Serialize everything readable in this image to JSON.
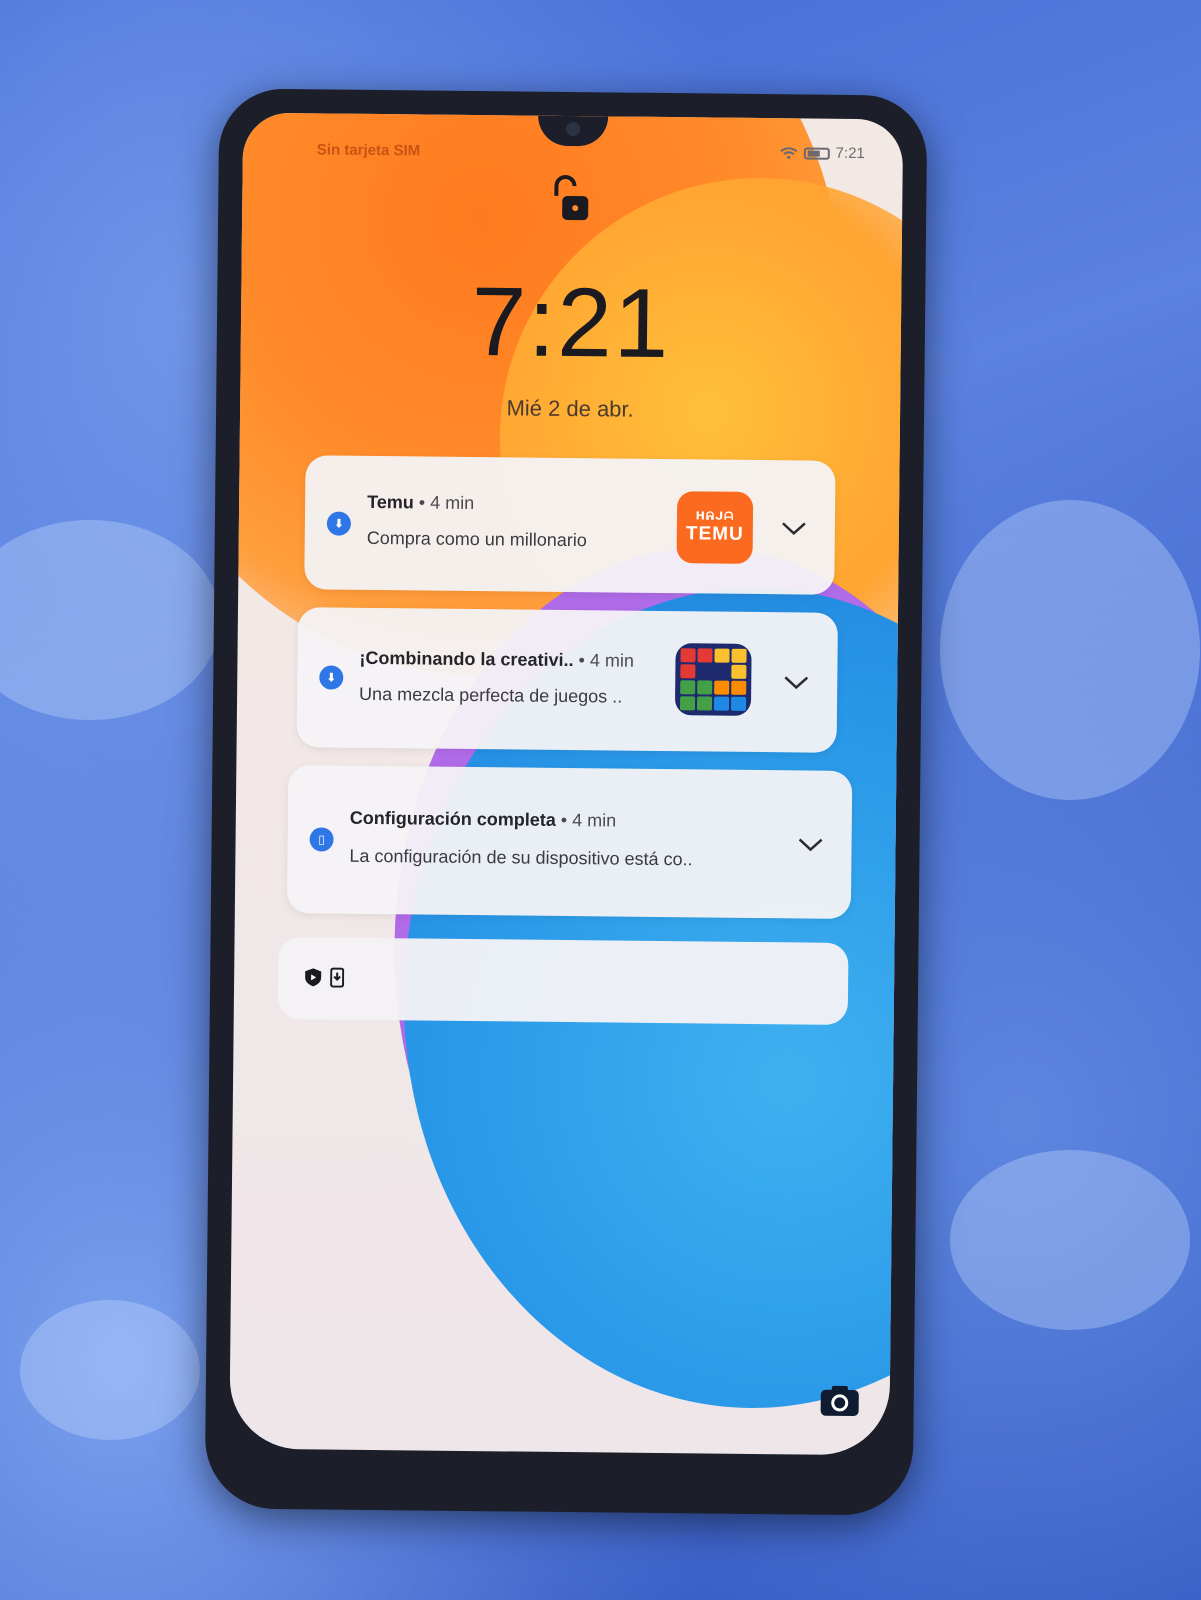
{
  "status_bar": {
    "carrier": "Sin tarjeta SIM",
    "time": "7:21",
    "icons": [
      "wifi-icon",
      "battery-icon"
    ]
  },
  "lockscreen": {
    "lock_icon": "unlock-icon",
    "clock": "7:21",
    "date": "Mié 2 de abr."
  },
  "notifications": [
    {
      "app": "Temu",
      "separator": "•",
      "time": "4 min",
      "body": "Compra como un millonario",
      "thumb_label": "TEMU",
      "thumb_small": "ᕼᕱᒍᗩ"
    },
    {
      "app": "¡Combinando la creativi..",
      "separator": "•",
      "time": "4 min",
      "body": "Una mezcla perfecta de juegos ..",
      "thumb": "block-puzzle-icon"
    },
    {
      "app": "Configuración completa",
      "separator": "•",
      "time": "4 min",
      "body": "La configuración de su dispositivo está co.."
    }
  ],
  "silent_bar": {
    "icons": [
      "shield-play-icon",
      "phone-download-icon"
    ]
  },
  "shortcuts": {
    "camera": "camera-icon"
  },
  "colors": {
    "temu_orange": "#fb6a1f",
    "accent_blue": "#2f77e6",
    "wallpaper_orange": "#ff7a1e",
    "wallpaper_blue": "#2b9be9",
    "wallpaper_purple": "#b06be8"
  }
}
